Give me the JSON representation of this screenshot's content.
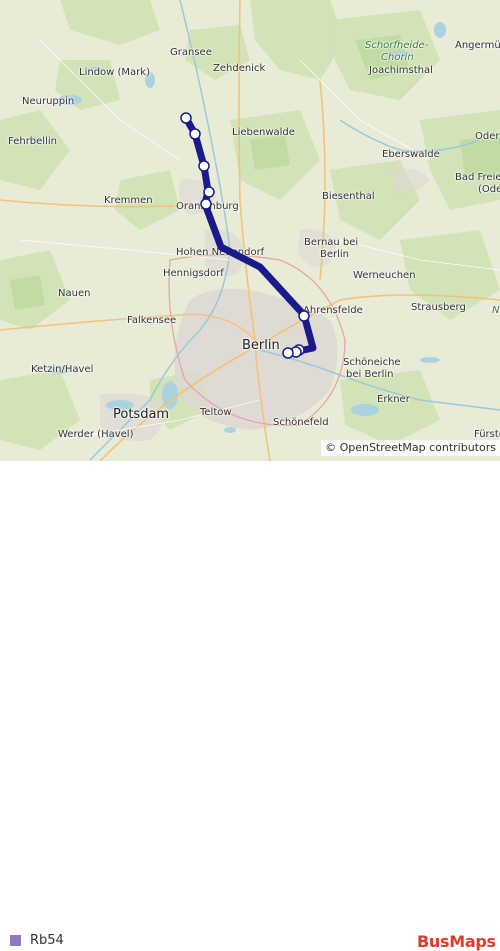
{
  "map": {
    "places": [
      {
        "id": "gransee",
        "label": "Gransee"
      },
      {
        "id": "zehdenick",
        "label": "Zehdenick"
      },
      {
        "id": "lindow",
        "label": "Lindow (Mark)"
      },
      {
        "id": "schorfheide",
        "label": "Schorfheide-"
      },
      {
        "id": "chorin",
        "label": "Chorin"
      },
      {
        "id": "angermuende",
        "label": "Angermün"
      },
      {
        "id": "joachimsthal",
        "label": "Joachimsthal"
      },
      {
        "id": "neuruppin",
        "label": "Neuruppin"
      },
      {
        "id": "liebenwalde",
        "label": "Liebenwalde"
      },
      {
        "id": "oder",
        "label": "Oder"
      },
      {
        "id": "fehrbellin",
        "label": "Fehrbellin"
      },
      {
        "id": "eberswalde",
        "label": "Eberswalde"
      },
      {
        "id": "badfreienwalde",
        "label": "Bad Freier"
      },
      {
        "id": "badfreienwalde2",
        "label": "(Ode"
      },
      {
        "id": "kremmen",
        "label": "Kremmen"
      },
      {
        "id": "oranienburg",
        "label": "Oranienburg"
      },
      {
        "id": "biesenthal",
        "label": "Biesenthal"
      },
      {
        "id": "bernau",
        "label": "Bernau bei"
      },
      {
        "id": "bernau2",
        "label": "Berlin"
      },
      {
        "id": "hohenneuendorf",
        "label": "Hohen Neuendorf"
      },
      {
        "id": "hennigsdorf",
        "label": "Hennigsdorf"
      },
      {
        "id": "werneuchen",
        "label": "Werneuchen"
      },
      {
        "id": "nauen",
        "label": "Nauen"
      },
      {
        "id": "falkensee",
        "label": "Falkensee"
      },
      {
        "id": "ahrensfelde",
        "label": "Ahrensfelde"
      },
      {
        "id": "strausberg",
        "label": "Strausberg"
      },
      {
        "id": "berlin",
        "label": "Berlin"
      },
      {
        "id": "ketzin",
        "label": "Ketzin/Havel"
      },
      {
        "id": "schoeneiche",
        "label": "Schöneiche"
      },
      {
        "id": "schoeneiche2",
        "label": "bei Berlin"
      },
      {
        "id": "potsdam",
        "label": "Potsdam"
      },
      {
        "id": "teltow",
        "label": "Teltow"
      },
      {
        "id": "erkner",
        "label": "Erkner"
      },
      {
        "id": "werder",
        "label": "Werder (Havel)"
      },
      {
        "id": "schoenefeld",
        "label": "Schönefeld"
      },
      {
        "id": "fuerstenwalde",
        "label": "Fürste"
      },
      {
        "id": "n_edge",
        "label": "N"
      }
    ],
    "route": {
      "name": "Rb54",
      "color": "#1a1a8c",
      "stop_count": 9
    },
    "attribution": {
      "copyright": "©",
      "link": "OpenStreetMap",
      "suffix": "contributors"
    }
  },
  "legend": {
    "label": "Rb54",
    "swatch_color": "#8e79c0"
  },
  "brand": {
    "part1": "Bus",
    "part2": "Maps"
  }
}
